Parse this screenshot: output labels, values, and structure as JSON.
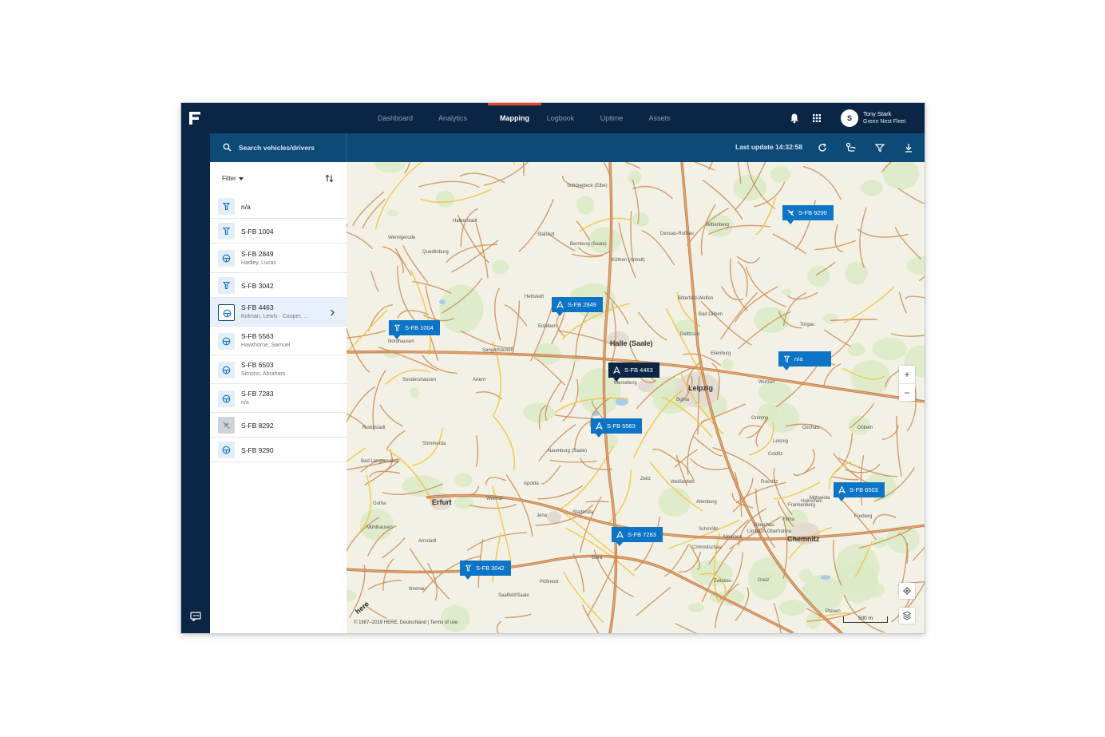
{
  "nav": {
    "tabs": [
      {
        "label": "Dashboard"
      },
      {
        "label": "Analytics"
      },
      {
        "label": "Mapping"
      },
      {
        "label": "Logbook"
      },
      {
        "label": "Uptime"
      },
      {
        "label": "Assets"
      }
    ],
    "active_tab": "Mapping"
  },
  "user": {
    "initial": "S",
    "name": "Tony Stark",
    "fleet": "Green Nest Fleet"
  },
  "toolbar": {
    "search_placeholder": "Search vehicles/drivers",
    "last_update": "Last update 14:32:58"
  },
  "sidebar": {
    "filter_label": "Filter",
    "vehicles": [
      {
        "name": "n/a",
        "driver": "",
        "icon": "pin-icon"
      },
      {
        "name": "S-FB 1004",
        "driver": "",
        "icon": "pin-icon"
      },
      {
        "name": "S-FB 2849",
        "driver": "Hadley, Lucas",
        "icon": "steering-wheel-icon"
      },
      {
        "name": "S-FB 3042",
        "driver": "",
        "icon": "pin-icon"
      },
      {
        "name": "S-FB 4463",
        "driver": "Kolman, Lewis · Cooper, ...",
        "icon": "steering-wheel-icon"
      },
      {
        "name": "S-FB 5563",
        "driver": "Hawthorne, Samuel",
        "icon": "steering-wheel-icon"
      },
      {
        "name": "S-FB 6503",
        "driver": "Simons, Abraham",
        "icon": "steering-wheel-icon"
      },
      {
        "name": "S-FB 7283",
        "driver": "n/a",
        "icon": "steering-wheel-icon"
      },
      {
        "name": "S-FB 8292",
        "driver": "",
        "icon": "offline-icon"
      },
      {
        "name": "S-FB 9290",
        "driver": "",
        "icon": "steering-wheel-icon"
      }
    ]
  },
  "map": {
    "cities_major": [
      "Leipzig",
      "Halle (Saale)",
      "Erfurt",
      "Chemnitz"
    ],
    "cities": [
      "Nordhausen",
      "Sangerhausen",
      "Merseburg",
      "Naumburg (Saale)",
      "Weimar",
      "Jena",
      "Gera",
      "Zwickau",
      "Altenburg",
      "Dessau-Roßlau",
      "Bernburg (Saale)",
      "Wittenberg",
      "Bitterfeld-Wolfen",
      "Delitzsch",
      "Eilenburg",
      "Torgau",
      "Grimma",
      "Borna",
      "Zeitz",
      "Weißenfels",
      "Eisleben",
      "Hettstedt",
      "Halberstadt",
      "Quedlinburg",
      "Wernigerode",
      "Sondershausen",
      "Mühlhausen",
      "Gotha",
      "Arnstadt",
      "Rudolstadt",
      "Saalfeld/Saale",
      "Pößneck",
      "Greiz",
      "Plauen",
      "Crimmitschau",
      "Glauchau",
      "Mittweida",
      "Freiberg",
      "Döbeln",
      "Oschatz",
      "Wurzen",
      "Schönebeck (Elbe)",
      "Staßfurt",
      "Köthen (Anhalt)",
      "Bad Düben",
      "Apolda",
      "Sömmerda",
      "Artern",
      "Bad Langensalza",
      "Ilmenau",
      "Stadtroda",
      "Schmölln",
      "Meerane",
      "Limbach-Oberfrohna",
      "Rochlitz",
      "Colditz",
      "Leisnig",
      "Hainichen",
      "Flöha",
      "Frankenberg"
    ],
    "pins": [
      {
        "label": "S-FB 9290",
        "icon": "no-signal-icon"
      },
      {
        "label": "S-FB 2849",
        "icon": "navigation-arrow-icon"
      },
      {
        "label": "S-FB 1004",
        "icon": "pin-icon"
      },
      {
        "label": "n/a",
        "icon": "pin-icon"
      },
      {
        "label": "S-FB 4463",
        "icon": "navigation-arrow-icon"
      },
      {
        "label": "S-FB 5563",
        "icon": "navigation-arrow-icon"
      },
      {
        "label": "S-FB 6503",
        "icon": "navigation-arrow-icon"
      },
      {
        "label": "S-FB 7283",
        "icon": "navigation-arrow-icon"
      },
      {
        "label": "S-FB 3042",
        "icon": "pin-icon"
      }
    ],
    "zoom_in": "+",
    "zoom_out": "−",
    "copyright": "© 1987–2019 HERE, Deutschland | Terms of use",
    "scale": "500 m",
    "provider": "here"
  },
  "colors": {
    "navy": "#0b2545",
    "toolbar_blue": "#0d4a78",
    "pin_blue": "#0d74c6",
    "active_tab_accent": "#e8452c"
  }
}
